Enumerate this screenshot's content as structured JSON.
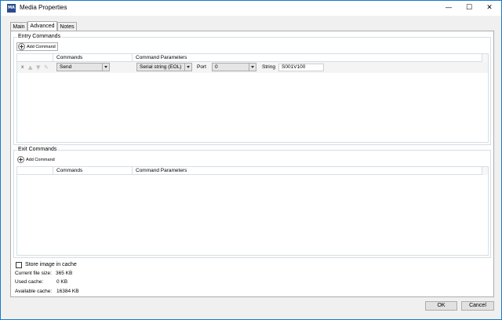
{
  "window": {
    "app_icon_text": "MA",
    "title": "Media Properties",
    "minimize_glyph": "—",
    "maximize_glyph": "☐",
    "close_glyph": "✕"
  },
  "tabs": [
    {
      "label": "Main",
      "active": false
    },
    {
      "label": "Advanced",
      "active": true
    },
    {
      "label": "Notes",
      "active": false
    }
  ],
  "entry": {
    "title": "Entry Commands",
    "add_label": "Add Command",
    "headers": {
      "commands": "Commands",
      "parameters": "Command Parameters"
    },
    "row": {
      "delete": "x",
      "command": "Send",
      "parameter_type": "Serial string (EOL)",
      "port_label": "Port",
      "port_value": "0",
      "string_label": "String",
      "string_value": "S001V100"
    }
  },
  "exit": {
    "title": "Exit Commands",
    "add_label": "Add Command",
    "headers": {
      "commands": "Commands",
      "parameters": "Command Parameters"
    }
  },
  "cache": {
    "store_label": "Store image in cache",
    "store_checked": false,
    "current_label": "Current file size:",
    "current_value": "365 KB",
    "used_label": "Used cache:",
    "used_value": "0 KB",
    "available_label": "Available cache:",
    "available_value": "16384 KB"
  },
  "buttons": {
    "ok": "OK",
    "cancel": "Cancel"
  },
  "icons": {
    "app": "app-logo-icon",
    "add": "plus-circle-icon",
    "move_up": "arrow-up-icon",
    "move_down": "arrow-down-icon",
    "edit": "edit-icon"
  }
}
